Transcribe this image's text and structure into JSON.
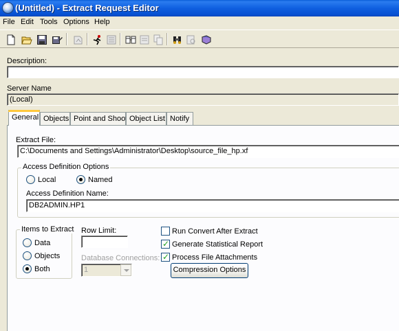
{
  "window": {
    "title": "(Untitled) - Extract Request Editor"
  },
  "menu": [
    "File",
    "Edit",
    "Tools",
    "Options",
    "Help"
  ],
  "toolbar": {
    "icons": [
      "new-icon",
      "open-icon",
      "save-icon",
      "save-as-icon",
      "undo-icon",
      "run-icon",
      "schedule-icon",
      "db-icon",
      "folder-icon",
      "copy-icon",
      "binoculars-icon",
      "book-icon"
    ]
  },
  "description": {
    "label": "Description:",
    "value": ""
  },
  "server": {
    "label": "Server Name",
    "value": "(Local)"
  },
  "tabs": [
    "General",
    "Objects",
    "Point and Shoot",
    "Object List",
    "Notify"
  ],
  "general": {
    "extract_file_label": "Extract File:",
    "extract_file_value": "C:\\Documents and Settings\\Administrator\\Desktop\\source_file_hp.xf",
    "access_definition": {
      "group_title": "Access Definition Options",
      "local_label": "Local",
      "named_label": "Named",
      "selected": "Named",
      "name_label": "Access Definition Name:",
      "name_value": "DB2ADMIN.HP1"
    },
    "items_to_extract": {
      "group_title": "Items to Extract",
      "options": [
        "Data",
        "Objects",
        "Both"
      ],
      "selected": "Both"
    },
    "row_limit": {
      "label": "Row Limit:",
      "value": ""
    },
    "database_connections": {
      "label": "Database Connections:",
      "value": "1"
    },
    "run_convert": {
      "label": "Run Convert After Extract",
      "checked": false
    },
    "generate_report": {
      "label": "Generate Statistical Report",
      "checked": true
    },
    "process_attachments": {
      "label": "Process File Attachments",
      "checked": true
    },
    "compression_button": "Compression Options"
  }
}
